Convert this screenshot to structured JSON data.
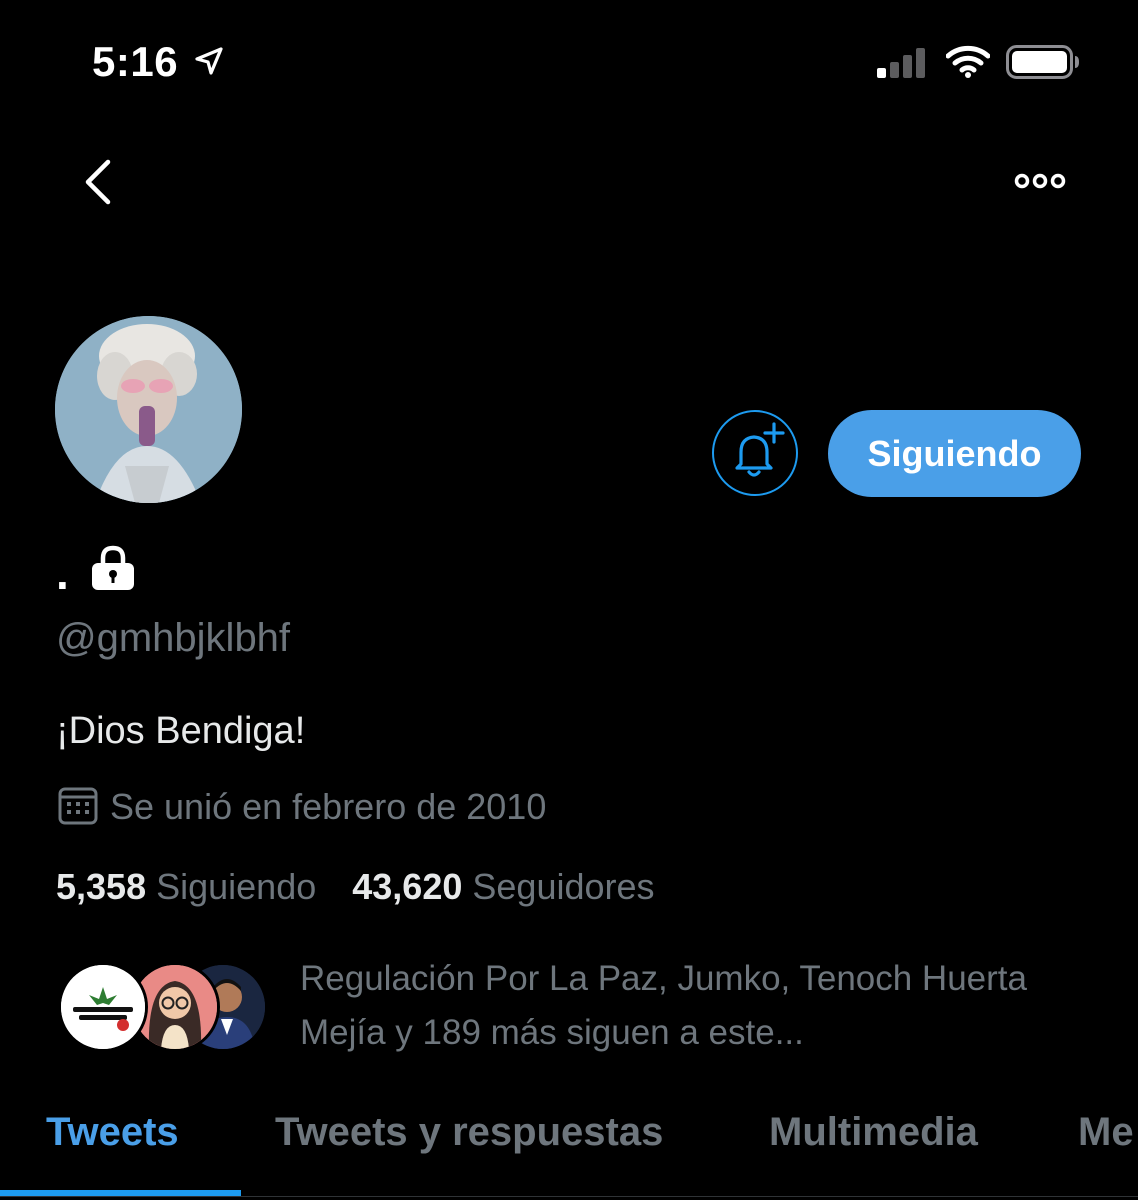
{
  "status_bar": {
    "time": "5:16"
  },
  "profile": {
    "display_name": ".",
    "handle": "@gmhbjklbhf",
    "bio": "¡Dios Bendiga!",
    "joined": "Se unió en febrero de 2010",
    "following_count": "5,358",
    "following_label": "Siguiendo",
    "followers_count": "43,620",
    "followers_label": "Seguidores",
    "followed_by": "Regulación Por La Paz, Jumko, Tenoch Huerta Mejía y 189 más siguen a este...",
    "follow_button_label": "Siguiendo"
  },
  "tabs": [
    {
      "label": "Tweets",
      "active": true
    },
    {
      "label": "Tweets y respuestas",
      "active": false
    },
    {
      "label": "Multimedia",
      "active": false
    },
    {
      "label": "Me",
      "active": false
    }
  ],
  "colors": {
    "accent": "#1d9bf0",
    "background": "#000000",
    "secondary_text": "#6e767d"
  }
}
